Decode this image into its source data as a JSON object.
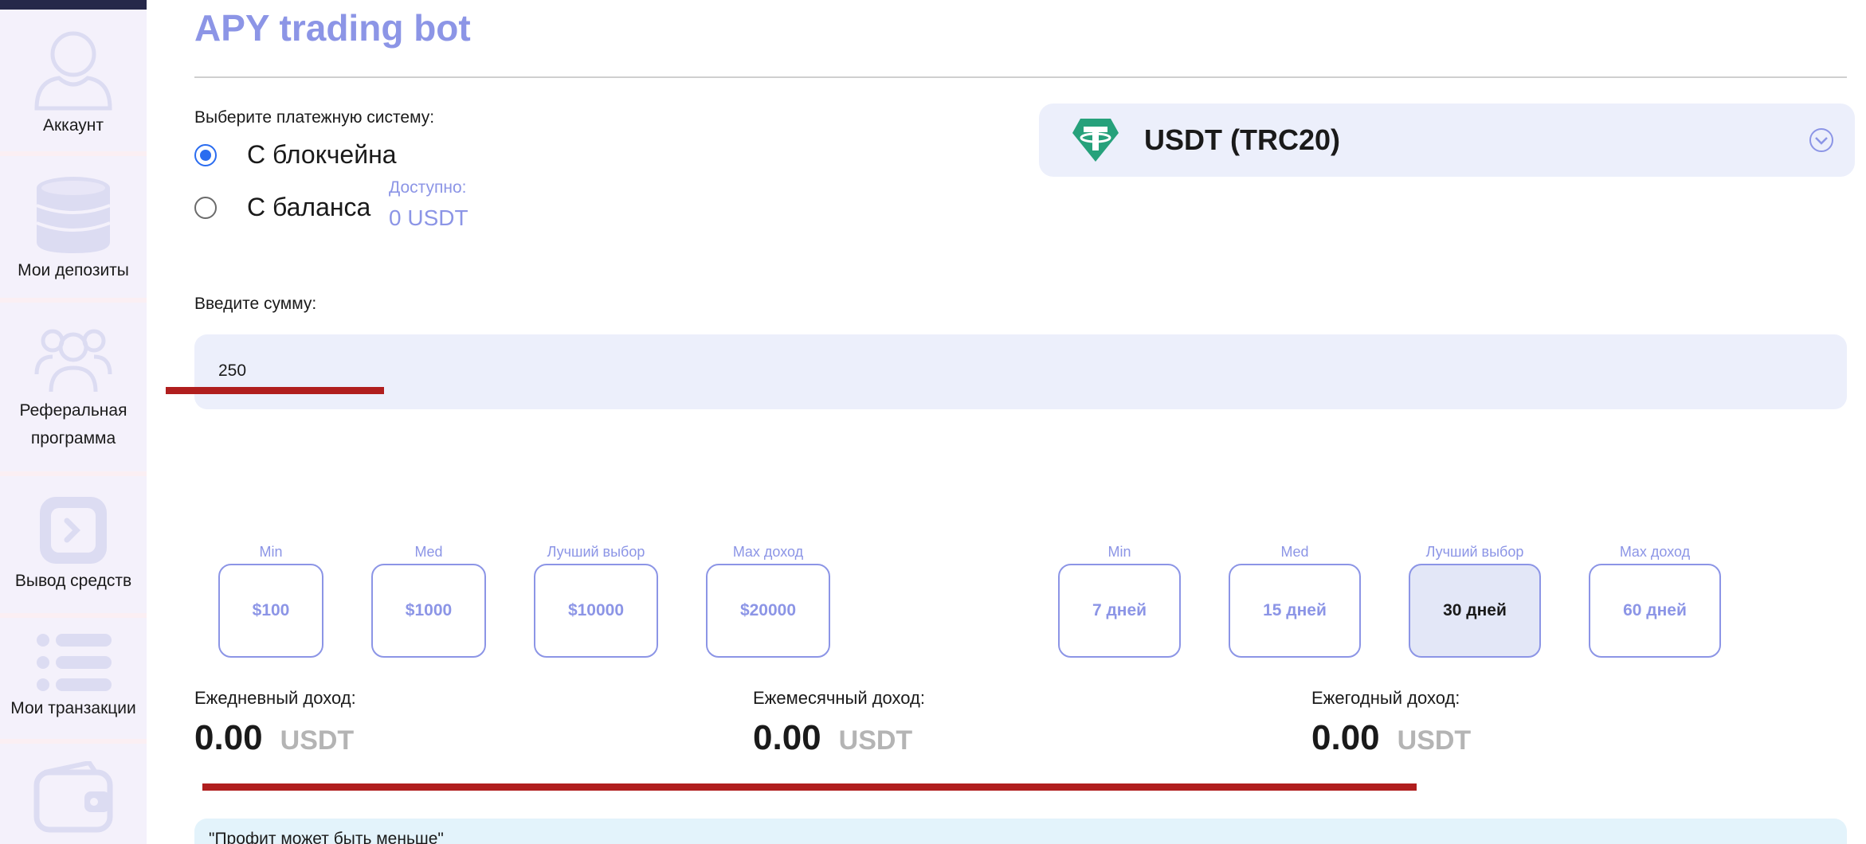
{
  "sidebar": {
    "items": [
      {
        "label": "Аккаунт",
        "icon": "user-icon"
      },
      {
        "label": "Мои депозиты",
        "icon": "coins-stack-icon"
      },
      {
        "label_line1": "Реферальная",
        "label_line2": "программа",
        "icon": "users-group-icon"
      },
      {
        "label": "Вывод средств",
        "icon": "withdraw-icon"
      },
      {
        "label": "Мои транзакции",
        "icon": "list-icon"
      },
      {
        "icon": "wallet-icon"
      }
    ]
  },
  "page": {
    "title": "APY trading bot"
  },
  "payment": {
    "label": "Выберите платежную систему:",
    "options": [
      {
        "label": "С блокчейна",
        "checked": true
      },
      {
        "label": "С баланса",
        "checked": false
      }
    ],
    "available_label": "Доступно:",
    "available_value": "0 USDT"
  },
  "currency_select": {
    "value": "USDT (TRC20)",
    "icon": "tether-icon"
  },
  "amount": {
    "label": "Введите сумму:",
    "value": "250"
  },
  "amount_presets": [
    {
      "caption": "Min",
      "label": "$100"
    },
    {
      "caption": "Med",
      "label": "$1000"
    },
    {
      "caption": "Лучший выбор",
      "label": "$10000"
    },
    {
      "caption": "Max доход",
      "label": "$20000"
    }
  ],
  "term_presets": [
    {
      "caption": "Min",
      "label": "7 дней"
    },
    {
      "caption": "Med",
      "label": "15 дней"
    },
    {
      "caption": "Лучший выбор",
      "label": "30 дней",
      "active": true
    },
    {
      "caption": "Max доход",
      "label": "60 дней"
    }
  ],
  "income": [
    {
      "label": "Ежедневный доход:",
      "value": "0.00",
      "currency": "USDT"
    },
    {
      "label": "Ежемесячный доход:",
      "value": "0.00",
      "currency": "USDT"
    },
    {
      "label": "Ежегодный доход:",
      "value": "0.00",
      "currency": "USDT"
    }
  ],
  "notice": {
    "text": "\"Профит может быть меньше\""
  },
  "colors": {
    "accent": "#8c95e6",
    "radio_checked": "#2a6cf0",
    "annotation_red": "#b01e1e",
    "sidebar_bg": "#f4f1fb",
    "tether_green": "#26a17b"
  }
}
